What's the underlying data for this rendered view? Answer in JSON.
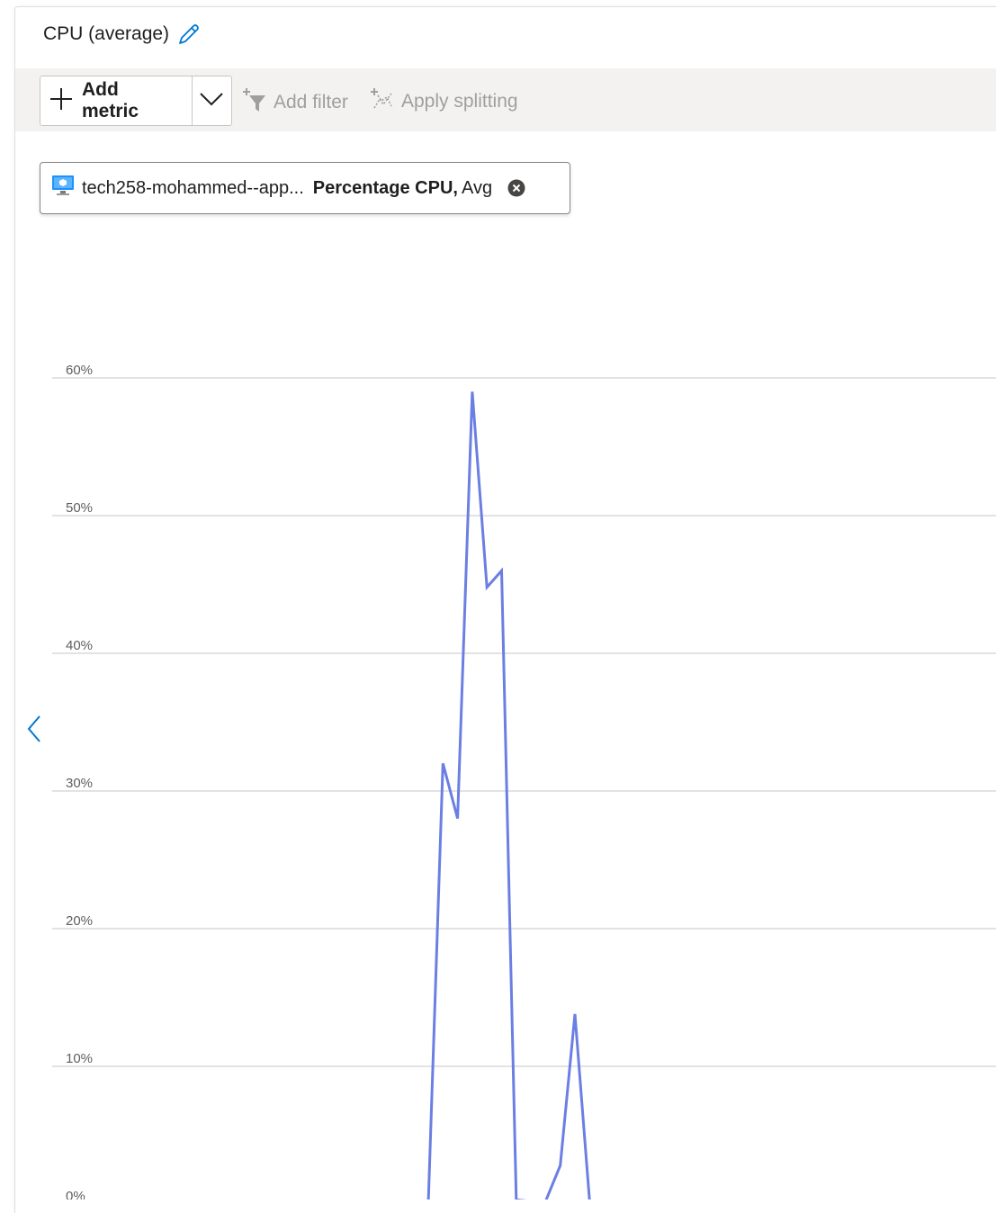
{
  "header": {
    "title": "CPU (average)"
  },
  "toolbar": {
    "add_metric": "Add metric",
    "add_filter": "Add filter",
    "apply_splitting": "Apply splitting"
  },
  "metric_pill": {
    "resource": "tech258-mohammed--app...",
    "metric": "Percentage CPU,",
    "aggregation": "Avg"
  },
  "colors": {
    "series": "#6b7fe3",
    "accent": "#0078d4",
    "grid": "#c8c6c4"
  },
  "chart_data": {
    "type": "line",
    "title": "CPU (average)",
    "xlabel": "",
    "ylabel": "",
    "ylim": [
      0,
      60
    ],
    "grid": true,
    "y_ticks": [
      "0%",
      "10%",
      "20%",
      "30%",
      "40%",
      "50%",
      "60%"
    ],
    "series": [
      {
        "name": "Percentage CPU, Avg",
        "no_data_dashed_until_index": 1,
        "values": [
          0,
          0,
          32,
          28,
          59,
          44.8,
          46,
          0.3,
          0.2,
          0.2,
          2.8,
          13.8,
          0.2,
          0.2,
          0.1,
          0.1,
          0.1,
          0.1,
          0.1,
          0.1,
          0.1,
          0.1,
          0.1,
          0.1,
          0.1,
          0.1,
          0.1,
          0.1,
          0.1,
          0.1,
          0.1,
          0.1,
          0.1,
          0.1,
          0.1,
          0.1,
          0.1,
          0.1,
          0.1,
          0.1,
          0.1,
          0.1,
          0.1,
          0.1,
          0.1,
          0.1,
          0
        ]
      }
    ]
  }
}
